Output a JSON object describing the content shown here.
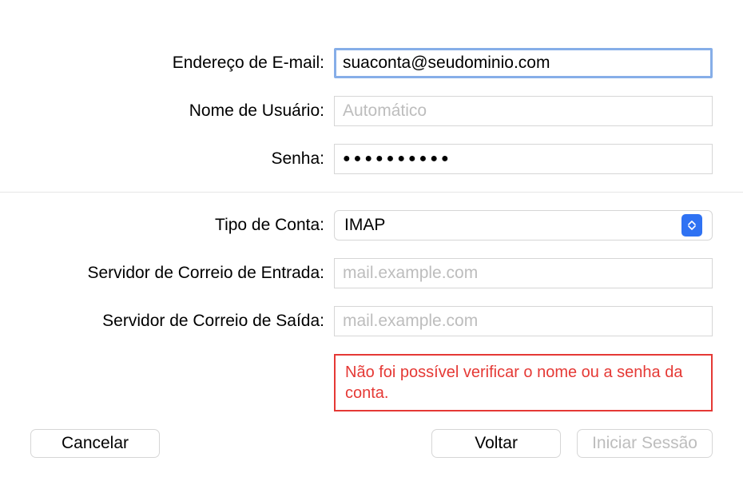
{
  "fields": {
    "email": {
      "label": "Endereço de E-mail:",
      "value": "suaconta@seudominio.com"
    },
    "username": {
      "label": "Nome de Usuário:",
      "placeholder": "Automático",
      "value": ""
    },
    "password": {
      "label": "Senha:",
      "masked": "●●●●●●●●●●"
    },
    "accountType": {
      "label": "Tipo de Conta:",
      "value": "IMAP"
    },
    "incoming": {
      "label": "Servidor de Correio de Entrada:",
      "placeholder": "mail.example.com",
      "value": ""
    },
    "outgoing": {
      "label": "Servidor de Correio de Saída:",
      "placeholder": "mail.example.com",
      "value": ""
    }
  },
  "error": "Não foi possível verificar o nome ou a senha da conta.",
  "buttons": {
    "cancel": "Cancelar",
    "back": "Voltar",
    "signin": "Iniciar Sessão"
  }
}
